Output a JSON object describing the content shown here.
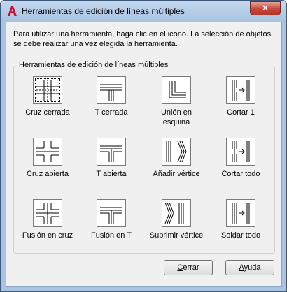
{
  "window": {
    "title": "Herramientas de edición de líneas múltiples",
    "close_label": "✕"
  },
  "instructions": "Para utilizar una herramienta, haga clic en el icono. La selección de objetos se debe realizar una vez elegida la herramienta.",
  "group": {
    "legend": "Herramientas de edición de líneas múltiples"
  },
  "tools": [
    {
      "label": "Cruz cerrada",
      "icon": "closed-cross-icon"
    },
    {
      "label": "T cerrada",
      "icon": "closed-tee-icon"
    },
    {
      "label": "Unión en esquina",
      "icon": "corner-joint-icon"
    },
    {
      "label": "Cortar 1",
      "icon": "cut-single-icon"
    },
    {
      "label": "Cruz abierta",
      "icon": "open-cross-icon"
    },
    {
      "label": "T abierta",
      "icon": "open-tee-icon"
    },
    {
      "label": "Añadir vértice",
      "icon": "add-vertex-icon"
    },
    {
      "label": "Cortar todo",
      "icon": "cut-all-icon"
    },
    {
      "label": "Fusión en cruz",
      "icon": "merged-cross-icon"
    },
    {
      "label": "Fusión en T",
      "icon": "merged-tee-icon"
    },
    {
      "label": "Suprimir vértice",
      "icon": "delete-vertex-icon"
    },
    {
      "label": "Soldar todo",
      "icon": "weld-all-icon"
    }
  ],
  "buttons": {
    "close_first": "C",
    "close_rest": "errar",
    "help_first": "A",
    "help_rest": "yuda"
  }
}
